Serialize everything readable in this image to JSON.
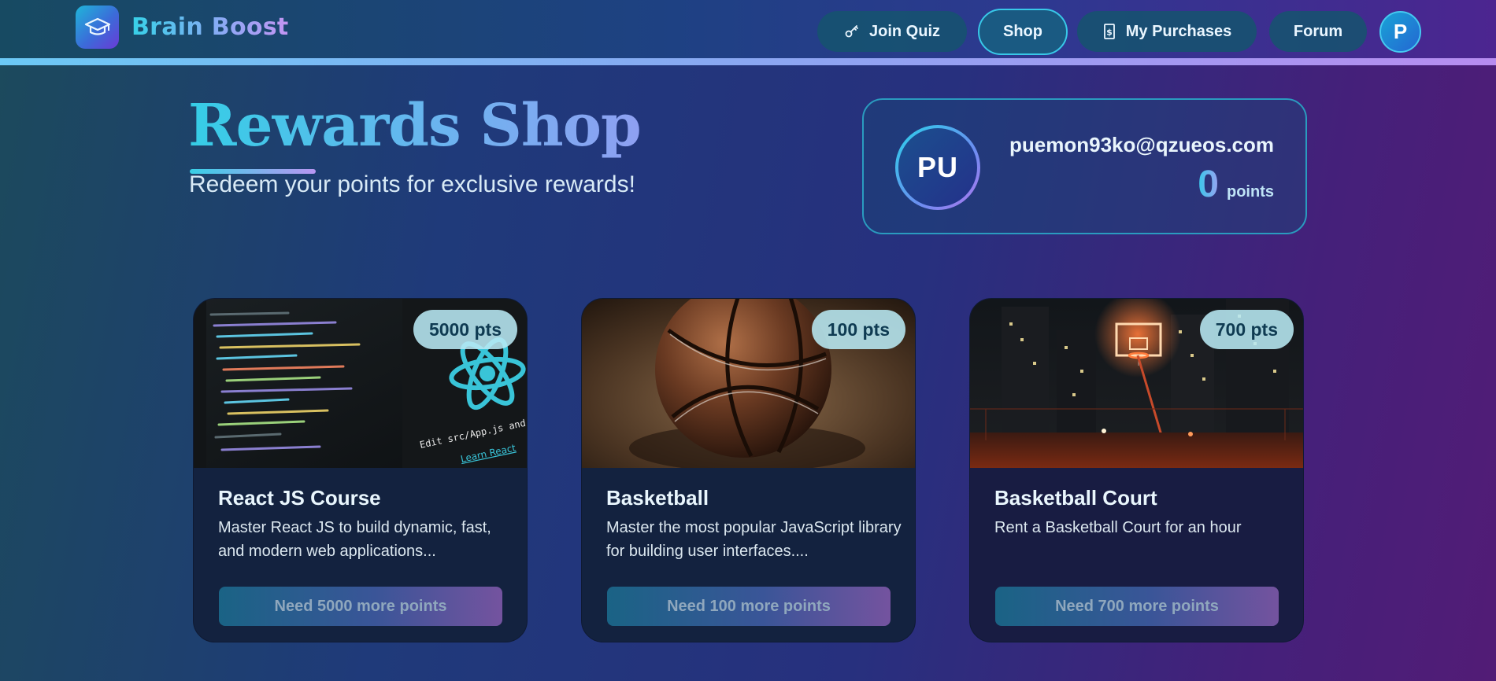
{
  "brand": {
    "name": "Brain Boost",
    "logo_icon": "graduation-cap-icon"
  },
  "nav": {
    "join_quiz": "Join Quiz",
    "shop": "Shop",
    "my_purchases": "My Purchases",
    "forum": "Forum",
    "avatar_initial": "P",
    "active": "Shop"
  },
  "hero": {
    "title": "Rewards Shop",
    "subtitle": "Redeem your points for exclusive rewards!"
  },
  "user": {
    "initials": "PU",
    "email": "puemon93ko@qzueos.com",
    "points": "0",
    "points_unit": "points"
  },
  "products": [
    {
      "name": "React JS Course",
      "description": "Master React JS to build dynamic, fast, and modern web applications...",
      "price": "5000 pts",
      "button": "Need 5000 more points",
      "image": "code-editor-react-logo"
    },
    {
      "name": "Basketball",
      "description": "Master the most popular JavaScript library for building user interfaces....",
      "price": "100 pts",
      "button": "Need 100 more points",
      "image": "basketball-on-floor"
    },
    {
      "name": "Basketball Court",
      "description": "Rent a Basketball Court for an hour",
      "price": "700 pts",
      "button": "Need 700 more points",
      "image": "night-basketball-court"
    }
  ],
  "image_text": {
    "react_caption": "Edit src/App.js and save to rel",
    "react_link": "Learn React"
  },
  "colors": {
    "accent_cyan": "#38c8e8",
    "accent_purple": "#b78cf0",
    "card_bg": "#13223f"
  }
}
